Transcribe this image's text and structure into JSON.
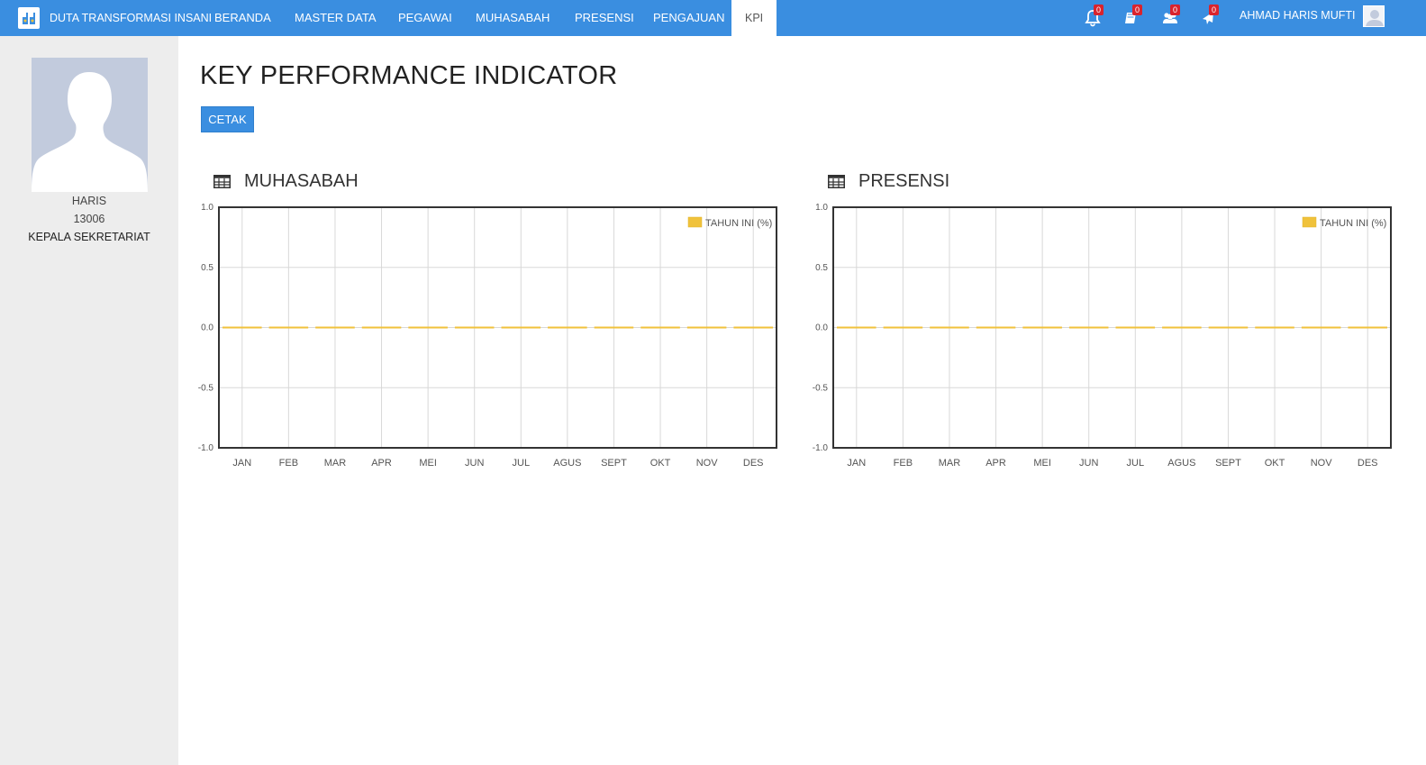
{
  "navbar": {
    "brand": "DUTA TRANSFORMASI INSANI",
    "items": [
      {
        "label": "BERANDA"
      },
      {
        "label": "MASTER DATA"
      },
      {
        "label": "PEGAWAI"
      },
      {
        "label": "MUHASABAH"
      },
      {
        "label": "PRESENSI"
      },
      {
        "label": "PENGAJUAN"
      },
      {
        "label": "KPI",
        "active": true
      }
    ],
    "icons": [
      {
        "name": "bell-icon",
        "badge": "0"
      },
      {
        "name": "book-icon",
        "badge": "0"
      },
      {
        "name": "users-icon",
        "badge": "0"
      },
      {
        "name": "plane-icon",
        "badge": "0"
      }
    ],
    "user_name": "AHMAD HARIS MUFTI",
    "color": "#3a8ee0"
  },
  "profile": {
    "name": "HARIS",
    "id": "13006",
    "position": "KEPALA SEKRETARIAT"
  },
  "main": {
    "title": "KEY PERFORMANCE INDICATOR",
    "print_button": "CETAK"
  },
  "panels": [
    {
      "title": "MUHASABAH"
    },
    {
      "title": "PRESENSI"
    }
  ],
  "chart_data": [
    {
      "type": "line",
      "title": "MUHASABAH",
      "categories": [
        "JAN",
        "FEB",
        "MAR",
        "APR",
        "MEI",
        "JUN",
        "JUL",
        "AGUS",
        "SEPT",
        "OKT",
        "NOV",
        "DES"
      ],
      "series": [
        {
          "name": "TAHUN INI (%)",
          "values": [
            0,
            0,
            0,
            0,
            0,
            0,
            0,
            0,
            0,
            0,
            0,
            0
          ],
          "color": "#f0c23b"
        }
      ],
      "ylim": [
        -1.0,
        1.0
      ],
      "yticks": [
        "1.0",
        "0.5",
        "0.0",
        "-0.5",
        "-1.0"
      ],
      "grid": true,
      "legend": "top-right"
    },
    {
      "type": "line",
      "title": "PRESENSI",
      "categories": [
        "JAN",
        "FEB",
        "MAR",
        "APR",
        "MEI",
        "JUN",
        "JUL",
        "AGUS",
        "SEPT",
        "OKT",
        "NOV",
        "DES"
      ],
      "series": [
        {
          "name": "TAHUN INI (%)",
          "values": [
            0,
            0,
            0,
            0,
            0,
            0,
            0,
            0,
            0,
            0,
            0,
            0
          ],
          "color": "#f0c23b"
        }
      ],
      "ylim": [
        -1.0,
        1.0
      ],
      "yticks": [
        "1.0",
        "0.5",
        "0.0",
        "-0.5",
        "-1.0"
      ],
      "grid": true,
      "legend": "top-right"
    }
  ]
}
